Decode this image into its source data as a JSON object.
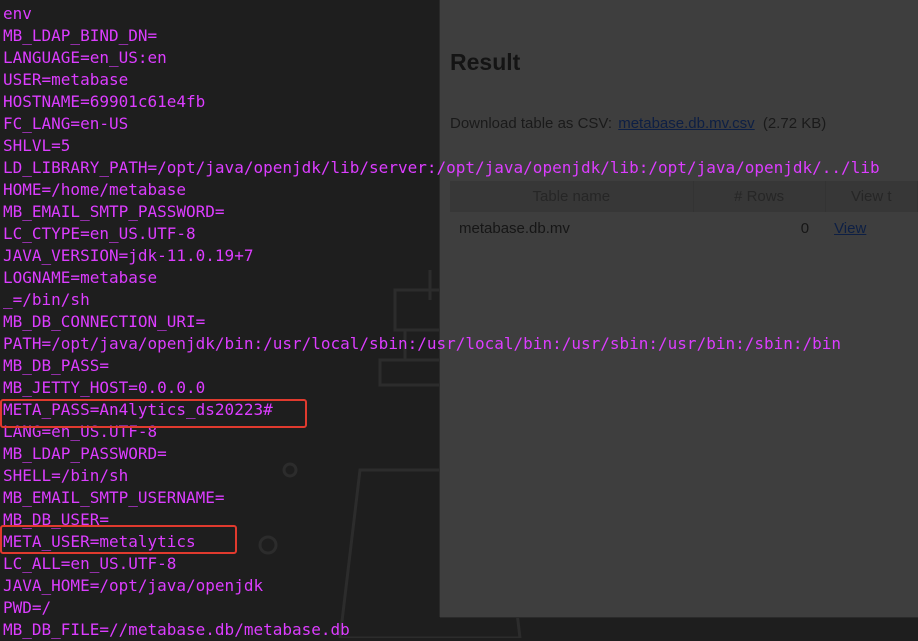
{
  "terminal": {
    "lines": [
      "env",
      "MB_LDAP_BIND_DN=",
      "LANGUAGE=en_US:en",
      "USER=metabase",
      "HOSTNAME=69901c61e4fb",
      "FC_LANG=en-US",
      "SHLVL=5",
      "LD_LIBRARY_PATH=/opt/java/openjdk/lib/server:/opt/java/openjdk/lib:/opt/java/openjdk/../lib",
      "HOME=/home/metabase",
      "MB_EMAIL_SMTP_PASSWORD=",
      "LC_CTYPE=en_US.UTF-8",
      "JAVA_VERSION=jdk-11.0.19+7",
      "LOGNAME=metabase",
      "_=/bin/sh",
      "MB_DB_CONNECTION_URI=",
      "PATH=/opt/java/openjdk/bin:/usr/local/sbin:/usr/local/bin:/usr/sbin:/usr/bin:/sbin:/bin",
      "MB_DB_PASS=",
      "MB_JETTY_HOST=0.0.0.0",
      "META_PASS=An4lytics_ds20223#",
      "LANG=en_US.UTF-8",
      "MB_LDAP_PASSWORD=",
      "SHELL=/bin/sh",
      "MB_EMAIL_SMTP_USERNAME=",
      "MB_DB_USER=",
      "META_USER=metalytics",
      "LC_ALL=en_US.UTF-8",
      "JAVA_HOME=/opt/java/openjdk",
      "PWD=/",
      "MB_DB_FILE=//metabase.db/metabase.db"
    ],
    "text_color": "#dc3dff",
    "highlight_color": "#e03a2e"
  },
  "browser": {
    "result_title": "Result",
    "download_prefix": "Download table as CSV:",
    "csv_link": "metabase.db.mv.csv",
    "csv_size": "(2.72 KB)",
    "table": {
      "headers": [
        "Table name",
        "# Rows",
        "View t"
      ],
      "rows": [
        {
          "name": "metabase.db.mv",
          "rows": "0",
          "view": "View"
        }
      ]
    }
  }
}
